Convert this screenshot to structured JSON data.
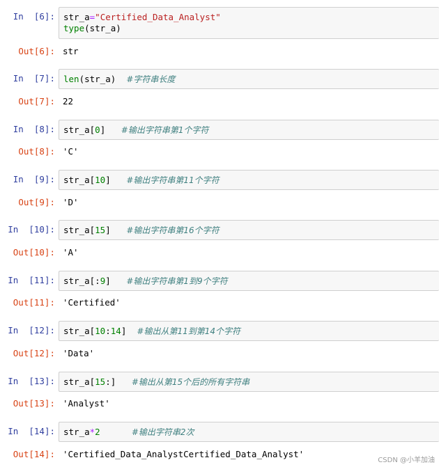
{
  "cells": [
    {
      "in_prompt": "In  [6]:",
      "out_prompt": "Out[6]:",
      "code_lines": [
        [
          {
            "t": "str_a",
            "c": "var"
          },
          {
            "t": "=",
            "c": "op"
          },
          {
            "t": "\"Certified_Data_Analyst\"",
            "c": "str"
          }
        ],
        [
          {
            "t": "type",
            "c": "builtin"
          },
          {
            "t": "(str_a)",
            "c": "var"
          }
        ]
      ],
      "output": "str"
    },
    {
      "in_prompt": "In  [7]:",
      "out_prompt": "Out[7]:",
      "code_lines": [
        [
          {
            "t": "len",
            "c": "builtin"
          },
          {
            "t": "(str_a)  ",
            "c": "var"
          },
          {
            "t": "#字符串长度",
            "c": "comment"
          }
        ]
      ],
      "output": "22"
    },
    {
      "in_prompt": "In  [8]:",
      "out_prompt": "Out[8]:",
      "code_lines": [
        [
          {
            "t": "str_a[",
            "c": "var"
          },
          {
            "t": "0",
            "c": "num"
          },
          {
            "t": "]   ",
            "c": "var"
          },
          {
            "t": "#输出字符串第1个字符",
            "c": "comment"
          }
        ]
      ],
      "output": "'C'"
    },
    {
      "in_prompt": "In  [9]:",
      "out_prompt": "Out[9]:",
      "code_lines": [
        [
          {
            "t": "str_a[",
            "c": "var"
          },
          {
            "t": "10",
            "c": "num"
          },
          {
            "t": "]   ",
            "c": "var"
          },
          {
            "t": "#输出字符串第11个字符",
            "c": "comment"
          }
        ]
      ],
      "output": "'D'"
    },
    {
      "in_prompt": "In  [10]:",
      "out_prompt": "Out[10]:",
      "code_lines": [
        [
          {
            "t": "str_a[",
            "c": "var"
          },
          {
            "t": "15",
            "c": "num"
          },
          {
            "t": "]   ",
            "c": "var"
          },
          {
            "t": "#输出字符串第16个字符",
            "c": "comment"
          }
        ]
      ],
      "output": "'A'"
    },
    {
      "in_prompt": "In  [11]:",
      "out_prompt": "Out[11]:",
      "code_lines": [
        [
          {
            "t": "str_a[:",
            "c": "var"
          },
          {
            "t": "9",
            "c": "num"
          },
          {
            "t": "]   ",
            "c": "var"
          },
          {
            "t": "#输出字符串第1到9个字符",
            "c": "comment"
          }
        ]
      ],
      "output": "'Certified'"
    },
    {
      "in_prompt": "In  [12]:",
      "out_prompt": "Out[12]:",
      "code_lines": [
        [
          {
            "t": "str_a[",
            "c": "var"
          },
          {
            "t": "10",
            "c": "num"
          },
          {
            "t": ":",
            "c": "var"
          },
          {
            "t": "14",
            "c": "num"
          },
          {
            "t": "]  ",
            "c": "var"
          },
          {
            "t": "#输出从第11到第14个字符",
            "c": "comment"
          }
        ]
      ],
      "output": "'Data'"
    },
    {
      "in_prompt": "In  [13]:",
      "out_prompt": "Out[13]:",
      "code_lines": [
        [
          {
            "t": "str_a[",
            "c": "var"
          },
          {
            "t": "15",
            "c": "num"
          },
          {
            "t": ":]   ",
            "c": "var"
          },
          {
            "t": "#输出从第15个后的所有字符串",
            "c": "comment"
          }
        ]
      ],
      "output": "'Analyst'"
    },
    {
      "in_prompt": "In  [14]:",
      "out_prompt": "Out[14]:",
      "code_lines": [
        [
          {
            "t": "str_a",
            "c": "var"
          },
          {
            "t": "*",
            "c": "op"
          },
          {
            "t": "2",
            "c": "num"
          },
          {
            "t": "      ",
            "c": "var"
          },
          {
            "t": "#输出字符串2次",
            "c": "comment"
          }
        ]
      ],
      "output": "'Certified_Data_AnalystCertified_Data_Analyst'"
    }
  ],
  "watermark": "CSDN @小羊加油"
}
